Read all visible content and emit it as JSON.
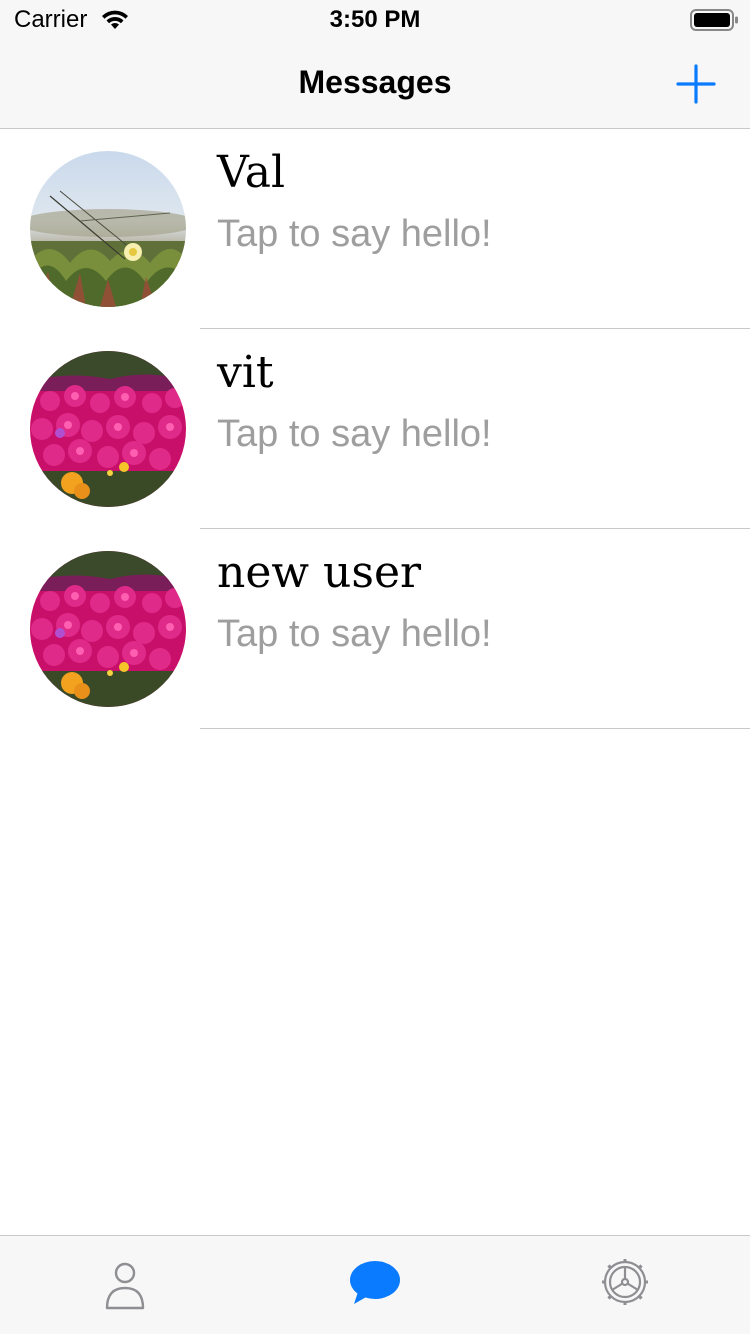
{
  "status_bar": {
    "carrier": "Carrier",
    "time": "3:50 PM",
    "wifi_icon": "wifi-icon",
    "battery_icon": "battery-icon"
  },
  "nav": {
    "title": "Messages",
    "add_icon": "plus-icon"
  },
  "messages": [
    {
      "name": "Val",
      "preview": "Tap to say hello!",
      "avatar": "dune-flower-photo"
    },
    {
      "name": "vit",
      "preview": "Tap to say hello!",
      "avatar": "magenta-flowers-photo"
    },
    {
      "name": "new user",
      "preview": "Tap to say hello!",
      "avatar": "magenta-flowers-photo"
    }
  ],
  "tab_bar": {
    "tabs": [
      {
        "icon": "person-icon",
        "selected": false
      },
      {
        "icon": "chat-bubble-icon",
        "selected": true
      },
      {
        "icon": "gear-icon",
        "selected": false
      }
    ]
  },
  "colors": {
    "accent": "#0a7aff",
    "secondary_text": "#9e9e9e",
    "inactive_icon": "#8e8e93",
    "bar_background": "#f7f7f7"
  }
}
